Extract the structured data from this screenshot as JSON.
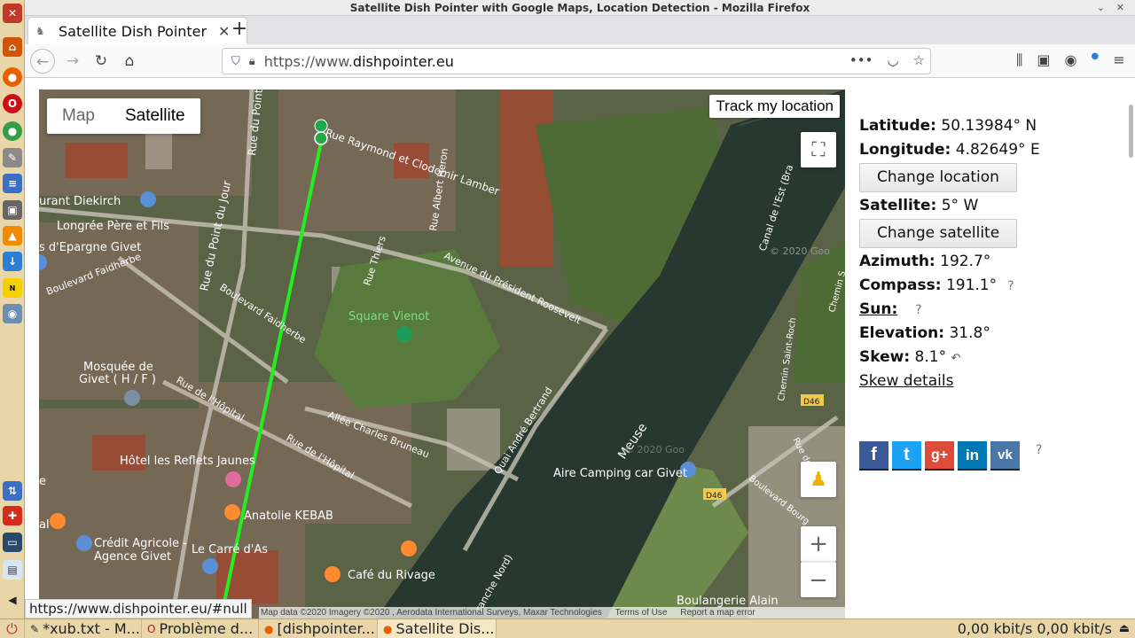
{
  "window": {
    "title": "Satellite Dish Pointer with Google Maps, Location Detection - Mozilla Firefox"
  },
  "browser": {
    "tab_title": "Satellite Dish Pointer with Google Maps, Location Detection",
    "url_prefix": "https://www.",
    "url_domain": "dishpointer.eu",
    "status_url": "https://www.dishpointer.eu/#null"
  },
  "map": {
    "type_map": "Map",
    "type_satellite": "Satellite",
    "track_location": "Track my location",
    "zoom_in": "+",
    "zoom_out": "−",
    "attribution": "Map data ©2020 Imagery ©2020 , Aerodata International Surveys, Maxar Technologies",
    "terms": "Terms of Use",
    "report": "Report a map error",
    "labels": {
      "rue_raymond": "Rue Raymond et Clodomir Lamber",
      "rue_point": "Rue du Point",
      "rue_point_du_jour": "Rue du Point du Jour",
      "diekirch": "urant Diekirch",
      "longree": "Longrée Père et Fils",
      "epargne": "s d'Epargne Givet",
      "faidherbe1": "Boulevard Faidherbe",
      "faidherbe2": "Boulevard Faidherbe",
      "rue_albert": "Rue Albert Heron",
      "avenue_roosevelt": "Avenue du Président Roosevelt",
      "rue_thiers": "Rue Thiers",
      "square_vienot": "Square Vienot",
      "mosquee": "Mosquée de",
      "mosquee2": "Givet ( H / F )",
      "rue_hopital": "Rue de l'Hôpital",
      "rue_hopital2": "Rue de l'Hôpital",
      "allee": "Allée Charles Bruneau",
      "quai": "Quai André Bertrand",
      "meuse": "Meuse",
      "canal": "Canal de l'Est (Bra",
      "hotel": "Hôtel les Reflets Jaunes",
      "anatolie": "Anatolie KEBAB",
      "credit1": "Crédit Agricole -",
      "credit2": "Agence Givet",
      "carre": "Le Carré d'As",
      "cafe": "Café du Rivage",
      "camping": "Aire Camping car Givet",
      "boulangerie": "Boulangerie Alain",
      "d46a": "D46",
      "d46b": "D46",
      "chemin_saint_roch": "Chemin Saint-Roch",
      "chemin_s": "Chemin S",
      "bd_bourg": "Boulevard Bourg",
      "rue_de": "Rue de P",
      "branche_nord": "ranche Nord)",
      "copyright1": "© 2020 Goo",
      "copyright2": "© 2020 Goo",
      "al": "al",
      "e_": "e"
    }
  },
  "info": {
    "latitude_label": "Latitude:",
    "latitude_value": "50.13984° N",
    "longitude_label": "Longitude:",
    "longitude_value": "4.82649° E",
    "change_location": "Change location",
    "satellite_label": "Satellite:",
    "satellite_value": "5° W",
    "change_satellite": "Change satellite",
    "azimuth_label": "Azimuth:",
    "azimuth_value": "192.7°",
    "compass_label": "Compass:",
    "compass_value": "191.1°",
    "help": "?",
    "sun_label": "Sun:",
    "elevation_label": "Elevation:",
    "elevation_value": "31.8°",
    "skew_label": "Skew:",
    "skew_value": "8.1°",
    "skew_details": "Skew details"
  },
  "social": {
    "fb": "f",
    "tw": "t",
    "gp": "g+",
    "li": "in",
    "vk": "vk",
    "help": "?"
  },
  "taskbar": {
    "items": [
      "*xub.txt - M...",
      "Problème d...",
      "[dishpointer...",
      "Satellite Dis..."
    ],
    "net": "0,00 kbit/s 0,00 kbit/s"
  },
  "colors": {
    "pointer_line": "#22ee22",
    "water": "#26382f"
  }
}
